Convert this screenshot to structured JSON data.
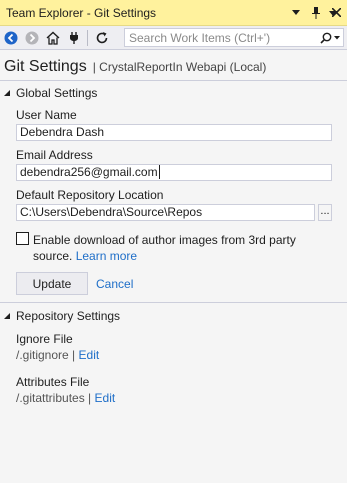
{
  "titlebar": {
    "title": "Team Explorer - Git Settings"
  },
  "toolbar": {
    "search_placeholder": "Search Work Items (Ctrl+')"
  },
  "header": {
    "title": "Git Settings",
    "subtitle": "| CrystalReportIn Webapi (Local)"
  },
  "global": {
    "heading": "Global Settings",
    "user_name_label": "User Name",
    "user_name_value": "Debendra Dash",
    "email_label": "Email Address",
    "email_value": "debendra256@gmail.com",
    "repo_label": "Default Repository Location",
    "repo_value": "C:\\Users\\Debendra\\Source\\Repos",
    "browse_label": "...",
    "checkbox_text": "Enable download of author images from 3rd party source.",
    "learn_more": "Learn more",
    "update_label": "Update",
    "cancel_label": "Cancel"
  },
  "repository": {
    "heading": "Repository Settings",
    "ignore_label": "Ignore File",
    "ignore_value": "/.gitignore",
    "attributes_label": "Attributes File",
    "attributes_value": "/.gitattributes",
    "separator": "|",
    "edit_label": "Edit"
  },
  "colors": {
    "titlebar": "#fff29d",
    "link": "#1e6ec8",
    "toolbar": "#eeeef2"
  }
}
